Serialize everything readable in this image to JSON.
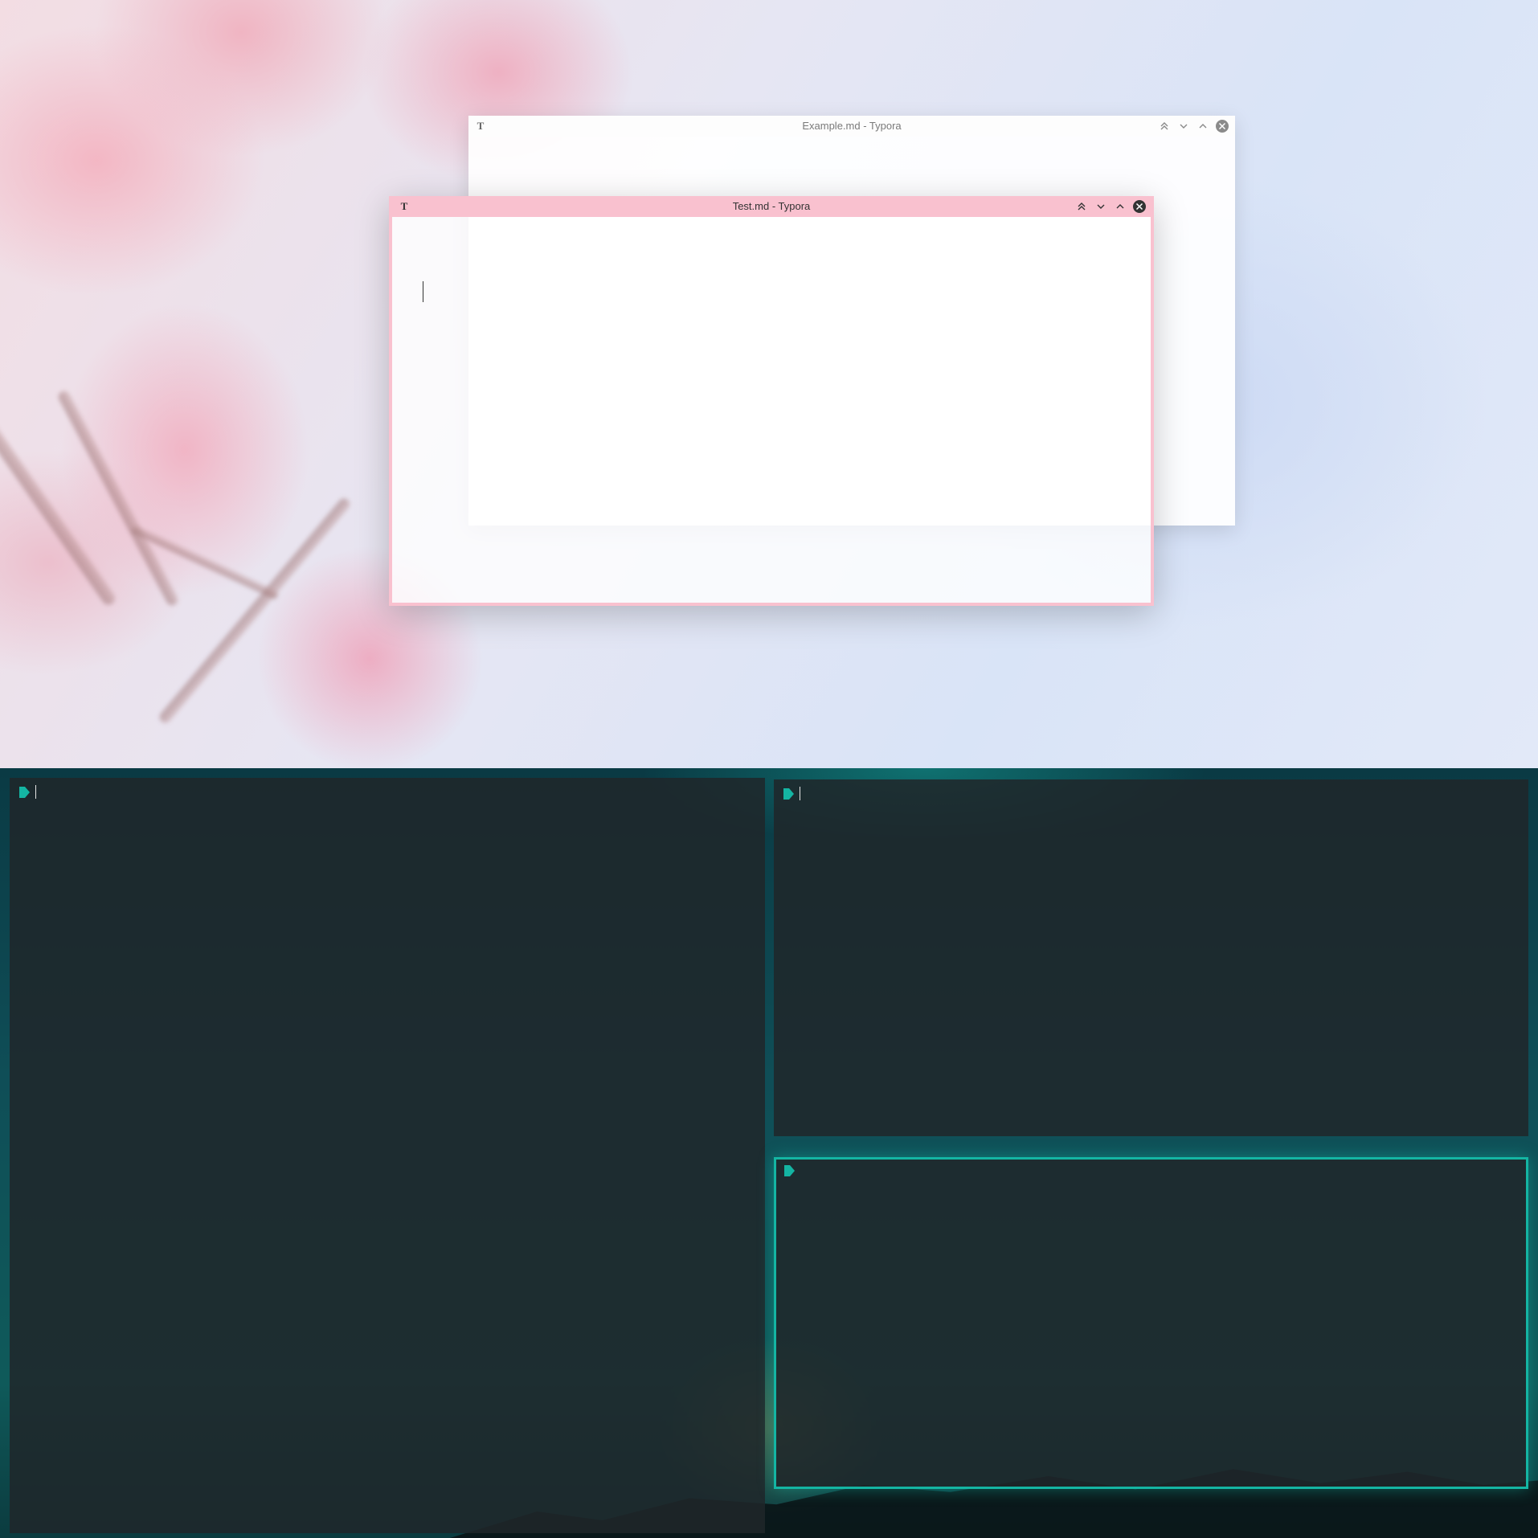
{
  "windows": {
    "example": {
      "title": "Example.md - Typora",
      "app_icon": "T",
      "controls": [
        "keep-above-icon",
        "minimize-icon",
        "maximize-icon",
        "close-icon"
      ]
    },
    "test": {
      "title": "Test.md - Typora",
      "app_icon": "T",
      "controls": [
        "keep-above-icon",
        "minimize-icon",
        "maximize-icon",
        "close-icon"
      ],
      "accent_color": "#f9c1cf"
    }
  },
  "terminals": {
    "left": {
      "prompt_icon": "prompt-arrow-icon",
      "text": ""
    },
    "top_right": {
      "prompt_icon": "prompt-arrow-icon",
      "text": ""
    },
    "bottom_right": {
      "prompt_icon": "prompt-arrow-icon",
      "text": "",
      "focused": true
    },
    "accent_color": "#14b5a3"
  }
}
